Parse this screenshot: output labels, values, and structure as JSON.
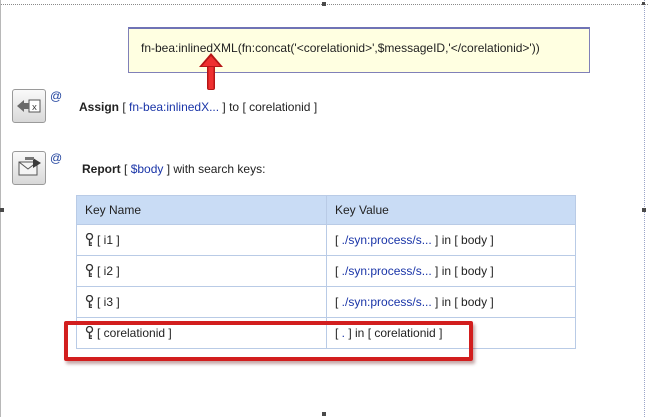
{
  "tooltip": {
    "text": "fn-bea:inlinedXML(fn:concat('<corelationid>',$messageID,'</corelationid>'))"
  },
  "assign": {
    "keyword": "Assign",
    "open": "[ ",
    "expression": "fn-bea:inlinedX...",
    "mid": " ] to [ ",
    "variable": "corelationid",
    "close": " ]",
    "at": "@"
  },
  "report": {
    "keyword": "Report",
    "open": " [ ",
    "expression": "$body",
    "suffix": " ] with search keys:",
    "at": "@"
  },
  "search_keys": {
    "headers": [
      "Key Name",
      "Key Value"
    ],
    "rows": [
      {
        "name": "[ i1 ]",
        "path": "./syn:process/s...",
        "var": " ] in [ body ]"
      },
      {
        "name": "[ i2 ]",
        "path": "./syn:process/s...",
        "var": " ] in [ body ]"
      },
      {
        "name": "[ i3 ]",
        "path": "./syn:process/s...",
        "var": " ] in [ body ]"
      },
      {
        "name": "[ corelationid ]",
        "path": ".",
        "var": " ] in [ corelationid ]"
      }
    ],
    "value_open": "[ "
  },
  "colors": {
    "highlight": "#d21e1e",
    "link": "#1a35a8",
    "header_bg": "#c9dcf5",
    "tooltip_bg": "#ffffe1"
  },
  "icons": [
    "assign-action-icon",
    "report-action-icon",
    "key-icon",
    "red-up-arrow"
  ]
}
